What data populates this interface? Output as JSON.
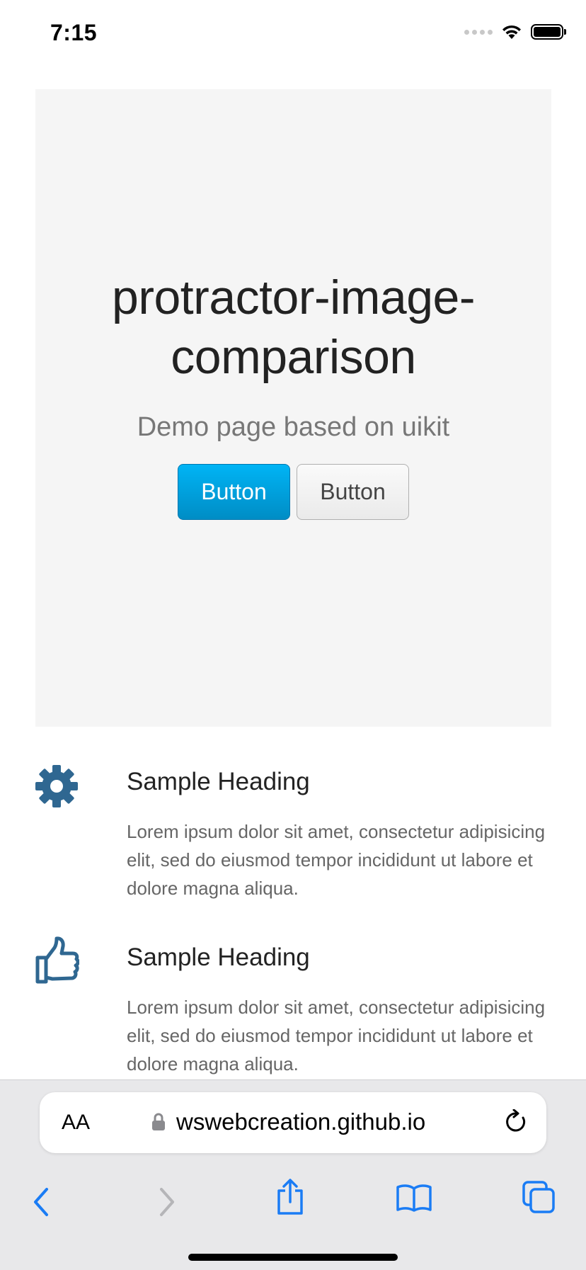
{
  "status_bar": {
    "time": "7:15"
  },
  "hero": {
    "title": "protractor-image-comparison",
    "subtitle": "Demo page based on uikit",
    "primary_button_label": "Button",
    "secondary_button_label": "Button"
  },
  "features": [
    {
      "icon": "gear-icon",
      "heading": "Sample Heading",
      "text": "Lorem ipsum dolor sit amet, consectetur adipisicing elit, sed do eiusmod tempor incididunt ut labore et dolore magna aliqua."
    },
    {
      "icon": "thumbs-up-icon",
      "heading": "Sample Heading",
      "text": "Lorem ipsum dolor sit amet, consectetur adipisicing elit, sed do eiusmod tempor incididunt ut labore et dolore magna aliqua."
    }
  ],
  "browser": {
    "text_size_label": "AA",
    "url": "wswebcreation.github.io"
  },
  "colors": {
    "primary": "#00a8e6",
    "icon": "#2f6791",
    "safari_blue": "#1a7cf5"
  }
}
